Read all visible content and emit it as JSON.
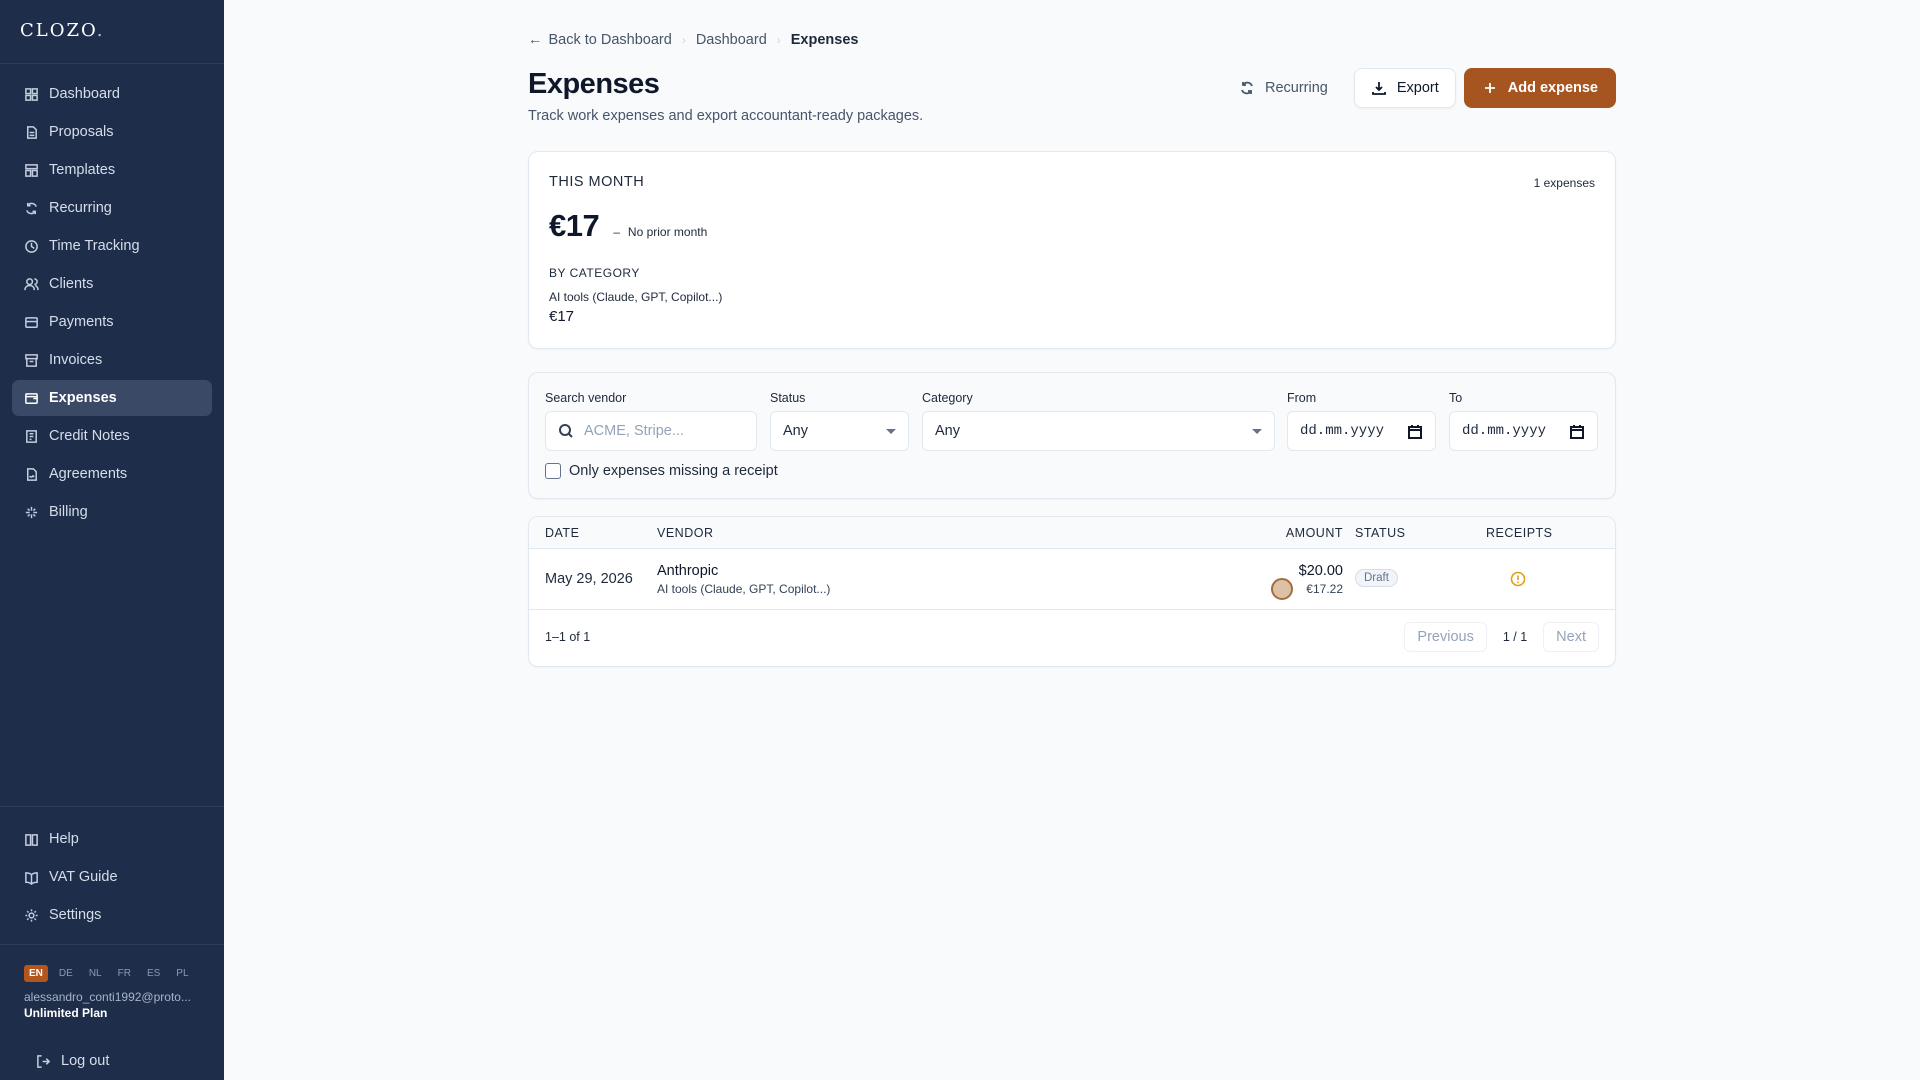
{
  "app": {
    "logo_text": "CLOZO",
    "logo_dot": "."
  },
  "sidebar": {
    "items": [
      {
        "label": "Dashboard",
        "icon": "dashboard-icon"
      },
      {
        "label": "Proposals",
        "icon": "document-icon"
      },
      {
        "label": "Templates",
        "icon": "template-icon"
      },
      {
        "label": "Recurring",
        "icon": "refresh-icon"
      },
      {
        "label": "Time Tracking",
        "icon": "clock-icon"
      },
      {
        "label": "Clients",
        "icon": "users-icon"
      },
      {
        "label": "Payments",
        "icon": "wallet-icon"
      },
      {
        "label": "Invoices",
        "icon": "archive-icon"
      },
      {
        "label": "Expenses",
        "icon": "wallet-card-icon",
        "active": true
      },
      {
        "label": "Credit Notes",
        "icon": "receipt-icon"
      },
      {
        "label": "Agreements",
        "icon": "file-signature-icon"
      },
      {
        "label": "Billing",
        "icon": "sparkles-icon"
      }
    ],
    "bottom_items": [
      {
        "label": "Help",
        "icon": "book-icon"
      },
      {
        "label": "VAT Guide",
        "icon": "book-open-icon"
      },
      {
        "label": "Settings",
        "icon": "gear-icon"
      }
    ],
    "languages": [
      "EN",
      "DE",
      "NL",
      "FR",
      "ES",
      "PL"
    ],
    "active_language": "EN",
    "user_email": "alessandro_conti1992@proto...",
    "plan": "Unlimited Plan",
    "logout": "Log out"
  },
  "breadcrumb": {
    "back": "Back to Dashboard",
    "parent": "Dashboard",
    "current": "Expenses"
  },
  "header": {
    "title": "Expenses",
    "subtitle": "Track work expenses and export accountant-ready packages.",
    "recurring_label": "Recurring",
    "export_label": "Export",
    "add_label": "Add expense",
    "accent_color": "#a65420"
  },
  "summary": {
    "period_label": "THIS MONTH",
    "count_label": "1 expenses",
    "total": "€17",
    "delta_dash": "–",
    "delta_text": "No prior month",
    "category_heading": "BY CATEGORY",
    "categories": [
      {
        "name": "AI tools (Claude, GPT, Copilot...)",
        "amount": "€17"
      }
    ]
  },
  "filters": {
    "search_label": "Search vendor",
    "search_placeholder": "ACME, Stripe...",
    "status_label": "Status",
    "status_value": "Any",
    "category_label": "Category",
    "category_value": "Any",
    "from_label": "From",
    "from_value": "dd.mm.yyyy",
    "to_label": "To",
    "to_value": "dd.mm.yyyy",
    "missing_receipt_label": "Only expenses missing a receipt"
  },
  "table": {
    "columns": [
      "DATE",
      "VENDOR",
      "AMOUNT",
      "STATUS",
      "RECEIPTS"
    ],
    "rows": [
      {
        "date": "May 29, 2026",
        "vendor": "Anthropic",
        "category": "AI tools (Claude, GPT, Copilot...)",
        "amount": "$20.00",
        "amount_converted": "€17.22",
        "status": "Draft",
        "receipt_icon": "warning-circle-icon"
      }
    ],
    "range_text": "1–1 of 1",
    "prev_label": "Previous",
    "page_text": "1 / 1",
    "next_label": "Next"
  }
}
